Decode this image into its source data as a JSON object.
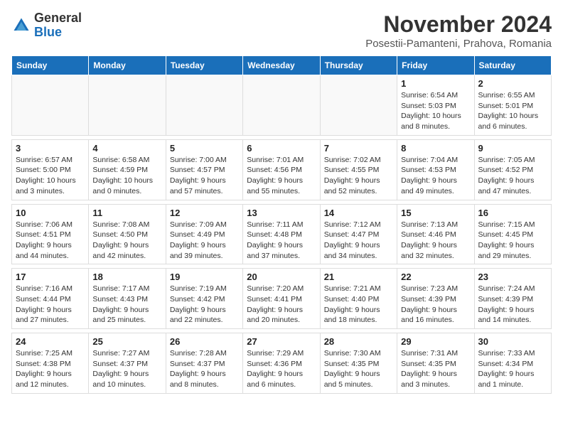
{
  "logo": {
    "general": "General",
    "blue": "Blue"
  },
  "title": "November 2024",
  "location": "Posestii-Pamanteni, Prahova, Romania",
  "days_of_week": [
    "Sunday",
    "Monday",
    "Tuesday",
    "Wednesday",
    "Thursday",
    "Friday",
    "Saturday"
  ],
  "weeks": [
    [
      {
        "day": "",
        "info": ""
      },
      {
        "day": "",
        "info": ""
      },
      {
        "day": "",
        "info": ""
      },
      {
        "day": "",
        "info": ""
      },
      {
        "day": "",
        "info": ""
      },
      {
        "day": "1",
        "info": "Sunrise: 6:54 AM\nSunset: 5:03 PM\nDaylight: 10 hours and 8 minutes."
      },
      {
        "day": "2",
        "info": "Sunrise: 6:55 AM\nSunset: 5:01 PM\nDaylight: 10 hours and 6 minutes."
      }
    ],
    [
      {
        "day": "3",
        "info": "Sunrise: 6:57 AM\nSunset: 5:00 PM\nDaylight: 10 hours and 3 minutes."
      },
      {
        "day": "4",
        "info": "Sunrise: 6:58 AM\nSunset: 4:59 PM\nDaylight: 10 hours and 0 minutes."
      },
      {
        "day": "5",
        "info": "Sunrise: 7:00 AM\nSunset: 4:57 PM\nDaylight: 9 hours and 57 minutes."
      },
      {
        "day": "6",
        "info": "Sunrise: 7:01 AM\nSunset: 4:56 PM\nDaylight: 9 hours and 55 minutes."
      },
      {
        "day": "7",
        "info": "Sunrise: 7:02 AM\nSunset: 4:55 PM\nDaylight: 9 hours and 52 minutes."
      },
      {
        "day": "8",
        "info": "Sunrise: 7:04 AM\nSunset: 4:53 PM\nDaylight: 9 hours and 49 minutes."
      },
      {
        "day": "9",
        "info": "Sunrise: 7:05 AM\nSunset: 4:52 PM\nDaylight: 9 hours and 47 minutes."
      }
    ],
    [
      {
        "day": "10",
        "info": "Sunrise: 7:06 AM\nSunset: 4:51 PM\nDaylight: 9 hours and 44 minutes."
      },
      {
        "day": "11",
        "info": "Sunrise: 7:08 AM\nSunset: 4:50 PM\nDaylight: 9 hours and 42 minutes."
      },
      {
        "day": "12",
        "info": "Sunrise: 7:09 AM\nSunset: 4:49 PM\nDaylight: 9 hours and 39 minutes."
      },
      {
        "day": "13",
        "info": "Sunrise: 7:11 AM\nSunset: 4:48 PM\nDaylight: 9 hours and 37 minutes."
      },
      {
        "day": "14",
        "info": "Sunrise: 7:12 AM\nSunset: 4:47 PM\nDaylight: 9 hours and 34 minutes."
      },
      {
        "day": "15",
        "info": "Sunrise: 7:13 AM\nSunset: 4:46 PM\nDaylight: 9 hours and 32 minutes."
      },
      {
        "day": "16",
        "info": "Sunrise: 7:15 AM\nSunset: 4:45 PM\nDaylight: 9 hours and 29 minutes."
      }
    ],
    [
      {
        "day": "17",
        "info": "Sunrise: 7:16 AM\nSunset: 4:44 PM\nDaylight: 9 hours and 27 minutes."
      },
      {
        "day": "18",
        "info": "Sunrise: 7:17 AM\nSunset: 4:43 PM\nDaylight: 9 hours and 25 minutes."
      },
      {
        "day": "19",
        "info": "Sunrise: 7:19 AM\nSunset: 4:42 PM\nDaylight: 9 hours and 22 minutes."
      },
      {
        "day": "20",
        "info": "Sunrise: 7:20 AM\nSunset: 4:41 PM\nDaylight: 9 hours and 20 minutes."
      },
      {
        "day": "21",
        "info": "Sunrise: 7:21 AM\nSunset: 4:40 PM\nDaylight: 9 hours and 18 minutes."
      },
      {
        "day": "22",
        "info": "Sunrise: 7:23 AM\nSunset: 4:39 PM\nDaylight: 9 hours and 16 minutes."
      },
      {
        "day": "23",
        "info": "Sunrise: 7:24 AM\nSunset: 4:39 PM\nDaylight: 9 hours and 14 minutes."
      }
    ],
    [
      {
        "day": "24",
        "info": "Sunrise: 7:25 AM\nSunset: 4:38 PM\nDaylight: 9 hours and 12 minutes."
      },
      {
        "day": "25",
        "info": "Sunrise: 7:27 AM\nSunset: 4:37 PM\nDaylight: 9 hours and 10 minutes."
      },
      {
        "day": "26",
        "info": "Sunrise: 7:28 AM\nSunset: 4:37 PM\nDaylight: 9 hours and 8 minutes."
      },
      {
        "day": "27",
        "info": "Sunrise: 7:29 AM\nSunset: 4:36 PM\nDaylight: 9 hours and 6 minutes."
      },
      {
        "day": "28",
        "info": "Sunrise: 7:30 AM\nSunset: 4:35 PM\nDaylight: 9 hours and 5 minutes."
      },
      {
        "day": "29",
        "info": "Sunrise: 7:31 AM\nSunset: 4:35 PM\nDaylight: 9 hours and 3 minutes."
      },
      {
        "day": "30",
        "info": "Sunrise: 7:33 AM\nSunset: 4:34 PM\nDaylight: 9 hours and 1 minute."
      }
    ]
  ]
}
